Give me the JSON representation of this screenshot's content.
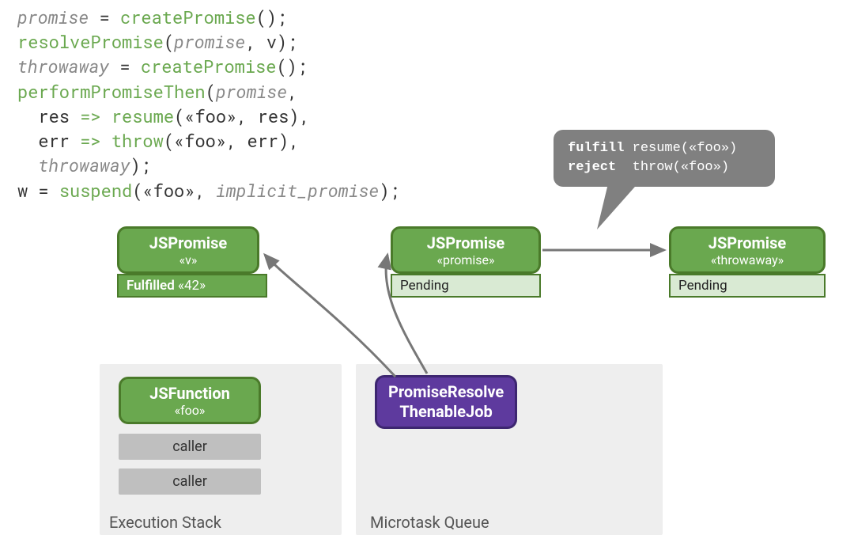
{
  "code": {
    "line1": {
      "var": "promise",
      "eq": " = ",
      "fn": "createPromise",
      "rest": "();"
    },
    "line2": {
      "fn": "resolvePromise",
      "paren1": "(",
      "arg1": "promise",
      "comma": ", v",
      "paren2": ");"
    },
    "line3": {
      "var": "throwaway",
      "eq": " = ",
      "fn": "createPromise",
      "rest": "();"
    },
    "line4": {
      "fn": "performPromiseThen",
      "paren1": "(",
      "arg1": "promise",
      "comma": ","
    },
    "line5": {
      "indent": "  res ",
      "arrow": "=>",
      "sp": " ",
      "fn": "resume",
      "rest": "(«foo», res),"
    },
    "line6": {
      "indent": "  err ",
      "arrow": "=>",
      "sp": " ",
      "fn": "throw",
      "rest": "(«foo», err),"
    },
    "line7": {
      "indent": "  ",
      "var": "throwaway",
      "rest": ");"
    },
    "line8": {
      "lhs": "w = ",
      "fn": "suspend",
      "paren1": "(«foo», ",
      "arg": "implicit_promise",
      "paren2": ");"
    }
  },
  "boxes": {
    "promise_v": {
      "title": "JSPromise",
      "sub": "«v»"
    },
    "promise_p": {
      "title": "JSPromise",
      "sub": "«promise»"
    },
    "promise_t": {
      "title": "JSPromise",
      "sub": "«throwaway»"
    },
    "status_fulfilled_label": "Fulfilled",
    "status_fulfilled_val": "«42»",
    "status_pending1": "Pending",
    "status_pending2": "Pending",
    "jsfunction": {
      "title": "JSFunction",
      "sub": "«foo»"
    },
    "caller1": "caller",
    "caller2": "caller",
    "purple": {
      "line1": "PromiseResolve",
      "line2": "ThenableJob"
    }
  },
  "containers": {
    "exec_stack": "Execution Stack",
    "microtask": "Microtask Queue"
  },
  "speech": {
    "line1_bold": "fulfill",
    "line1_rest": " resume(«foo»)",
    "line2_bold": "reject",
    "line2_rest": "  throw(«foo»)"
  }
}
